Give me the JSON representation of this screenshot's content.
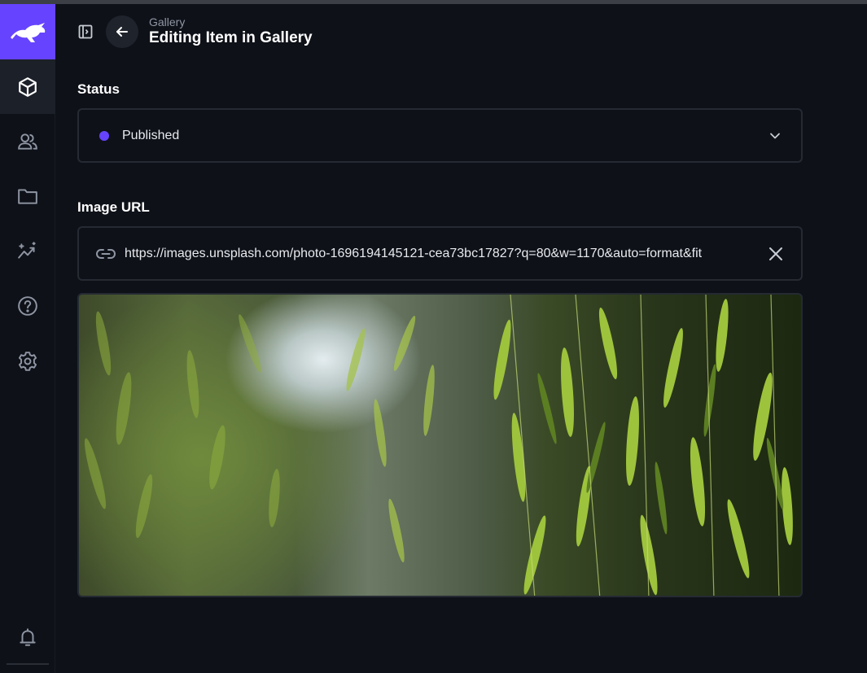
{
  "header": {
    "breadcrumb": "Gallery",
    "title": "Editing Item in Gallery"
  },
  "rail": {
    "items": [
      {
        "icon": "cube-icon",
        "active": true
      },
      {
        "icon": "users-icon",
        "active": false
      },
      {
        "icon": "folder-icon",
        "active": false
      },
      {
        "icon": "insights-icon",
        "active": false
      },
      {
        "icon": "help-icon",
        "active": false
      },
      {
        "icon": "gear-icon",
        "active": false
      }
    ],
    "bottom_icon": "bell-icon"
  },
  "fields": {
    "status": {
      "label": "Status",
      "value": "Published"
    },
    "image_url": {
      "label": "Image URL",
      "value": "https://images.unsplash.com/photo-1696194145121-cea73bc17827?q=80&w=1170&auto=format&fit"
    }
  },
  "colors": {
    "brand": "#6644ff",
    "background": "#0e1118",
    "border": "#252a33",
    "status_dot": "#6644ff"
  }
}
